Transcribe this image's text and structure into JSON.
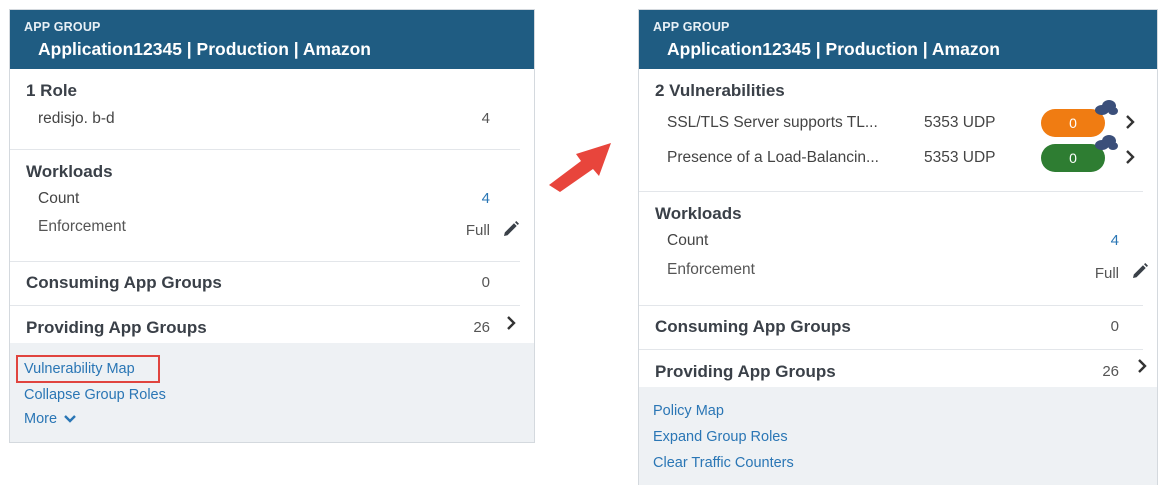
{
  "left_panel": {
    "header": {
      "kicker": "APP GROUP",
      "title": "Application12345 | Production | Amazon"
    },
    "roles": {
      "title": "1 Role",
      "items": [
        {
          "name": "redisjo. b-d",
          "value": "4"
        }
      ]
    },
    "workloads": {
      "title": "Workloads",
      "count_label": "Count",
      "count_value": "4",
      "enforcement_label": "Enforcement",
      "enforcement_value": "Full"
    },
    "consuming": {
      "label": "Consuming App Groups",
      "value": "0"
    },
    "providing": {
      "label": "Providing App Groups",
      "value": "26"
    },
    "footer_links": [
      "Vulnerability Map",
      "Collapse Group Roles",
      "More"
    ]
  },
  "right_panel": {
    "header": {
      "kicker": "APP GROUP",
      "title": "Application12345 | Production | Amazon"
    },
    "vulnerabilities": {
      "title": "2 Vulnerabilities",
      "items": [
        {
          "name": "SSL/TLS Server supports TL...",
          "port": "5353 UDP",
          "score": "0",
          "color": "#f07c12"
        },
        {
          "name": "Presence of a Load-Balancin...",
          "port": "5353 UDP",
          "score": "0",
          "color": "#2e7d32"
        }
      ]
    },
    "workloads": {
      "title": "Workloads",
      "count_label": "Count",
      "count_value": "4",
      "enforcement_label": "Enforcement",
      "enforcement_value": "Full"
    },
    "consuming": {
      "label": "Consuming App Groups",
      "value": "0"
    },
    "providing": {
      "label": "Providing App Groups",
      "value": "26"
    },
    "footer_links": [
      "Policy Map",
      "Expand Group Roles",
      "Clear Traffic Counters"
    ]
  },
  "colors": {
    "header_bg": "#1f5c82",
    "link": "#2a76b5",
    "highlight_box": "#e0443e",
    "arrow": "#e8453c",
    "cloud": "#3b4f7a"
  },
  "icons": {
    "edit": "pencil-icon",
    "expand": "chevron-right-icon",
    "more": "chevron-down-icon",
    "cloud": "cloud-icon",
    "arrow": "arrow-icon"
  }
}
